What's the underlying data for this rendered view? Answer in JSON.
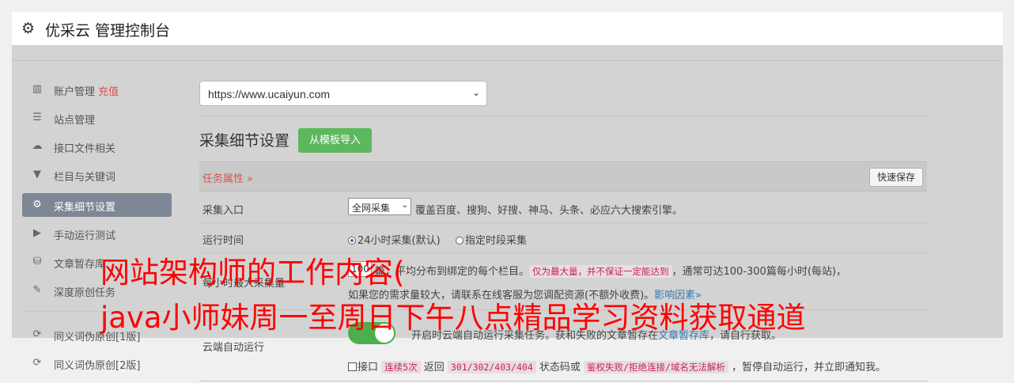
{
  "header": {
    "title": "优采云 管理控制台",
    "icon": "gear-icon"
  },
  "sidebar": {
    "items": [
      {
        "label": "账户管理",
        "extra": "充值",
        "icon": "bar-chart-icon"
      },
      {
        "label": "站点管理",
        "icon": "server-icon"
      },
      {
        "label": "接口文件相关",
        "icon": "cloud-upload-icon"
      },
      {
        "label": "栏目与关键词",
        "icon": "filter-icon"
      },
      {
        "label": "采集细节设置",
        "icon": "gears-icon",
        "active": true
      },
      {
        "label": "手动运行测试",
        "icon": "play-circle-icon"
      },
      {
        "label": "文章暂存库",
        "icon": "database-icon"
      },
      {
        "label": "深度原创任务",
        "icon": "edit-icon"
      },
      {
        "label": "同义词伪原创[1版]",
        "icon": "refresh-icon"
      },
      {
        "label": "同义词伪原创[2版]",
        "icon": "refresh-icon"
      }
    ]
  },
  "site_select": {
    "value": "https://www.ucaiyun.com"
  },
  "section": {
    "title": "采集细节设置",
    "import_button": "从模板导入"
  },
  "task_bar": {
    "label": "任务属性 »",
    "save_button": "快速保存"
  },
  "form": {
    "entry": {
      "label": "采集入口",
      "select_value": "全网采集",
      "desc": "覆盖百度、搜狗、好搜、神马、头条、必应六大搜索引擎。"
    },
    "runtime": {
      "label": "运行时间",
      "option1": "24小时采集(默认)",
      "option2": "指定时段采集"
    },
    "max": {
      "label": "每小时最大采集量",
      "value": "100",
      "text_a": "篇，平均分布到绑定的每个栏目。",
      "tag": "仅为最大量，并不保证一定能达到",
      "text_b": "，通常可达100-300篇每小时(每站)，",
      "line2": "如果您的需求量较大，请联系在线客服为您调配资源(不额外收费)。",
      "link": "影响因素»"
    },
    "cloud": {
      "label": "云端自动运行",
      "desc_a": "开启时云端自动运行采集任务。获和失败的文章暂存在",
      "link": "文章暂存库",
      "desc_b": "，请自行获取。",
      "cb_label": "接口",
      "tag1": "连续5次",
      "text1": "返回",
      "tag2": "301/302/403/404",
      "text2": "状态码或",
      "tag3": "鉴权失败/拒绝连接/域名无法解析",
      "text3": "，暂停自动运行，并立即通知我。"
    }
  },
  "overlay": {
    "line1": "网站架构师的工作内容(",
    "line2": "java小师妹周一至周日下午八点精品学习资料获取通道"
  }
}
